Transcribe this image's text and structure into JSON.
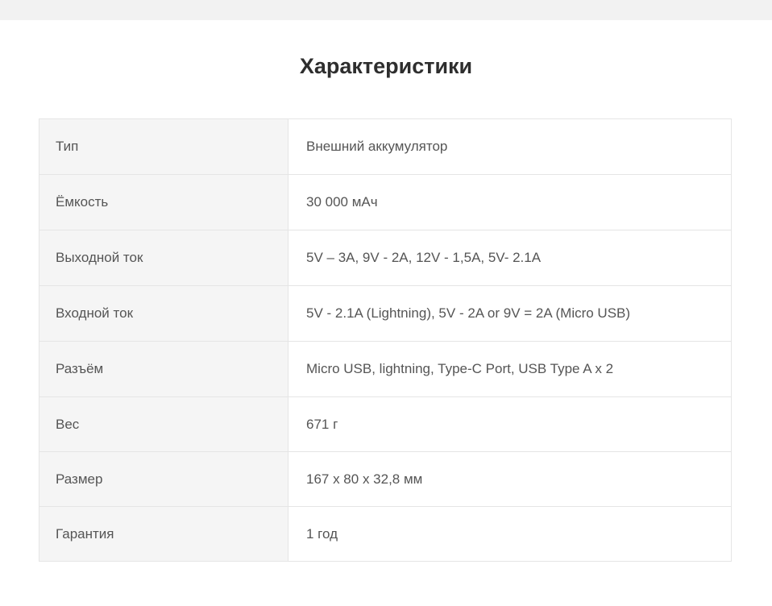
{
  "title": "Характеристики",
  "specs": [
    {
      "label": "Тип",
      "value": "Внешний аккумулятор"
    },
    {
      "label": "Ёмкость",
      "value": "30 000 мАч"
    },
    {
      "label": "Выходной ток",
      "value": "5V – 3A, 9V - 2A, 12V - 1,5A, 5V- 2.1A"
    },
    {
      "label": "Входной ток",
      "value": "5V - 2.1A (Lightning), 5V - 2A or 9V = 2A (Micro USB)"
    },
    {
      "label": "Разъём",
      "value": "Micro USB, lightning, Type-C Port, USB Type A x 2"
    },
    {
      "label": "Вес",
      "value": "671 г"
    },
    {
      "label": "Размер",
      "value": "167 x 80 x 32,8 мм"
    },
    {
      "label": "Гарантия",
      "value": "1 год"
    }
  ]
}
